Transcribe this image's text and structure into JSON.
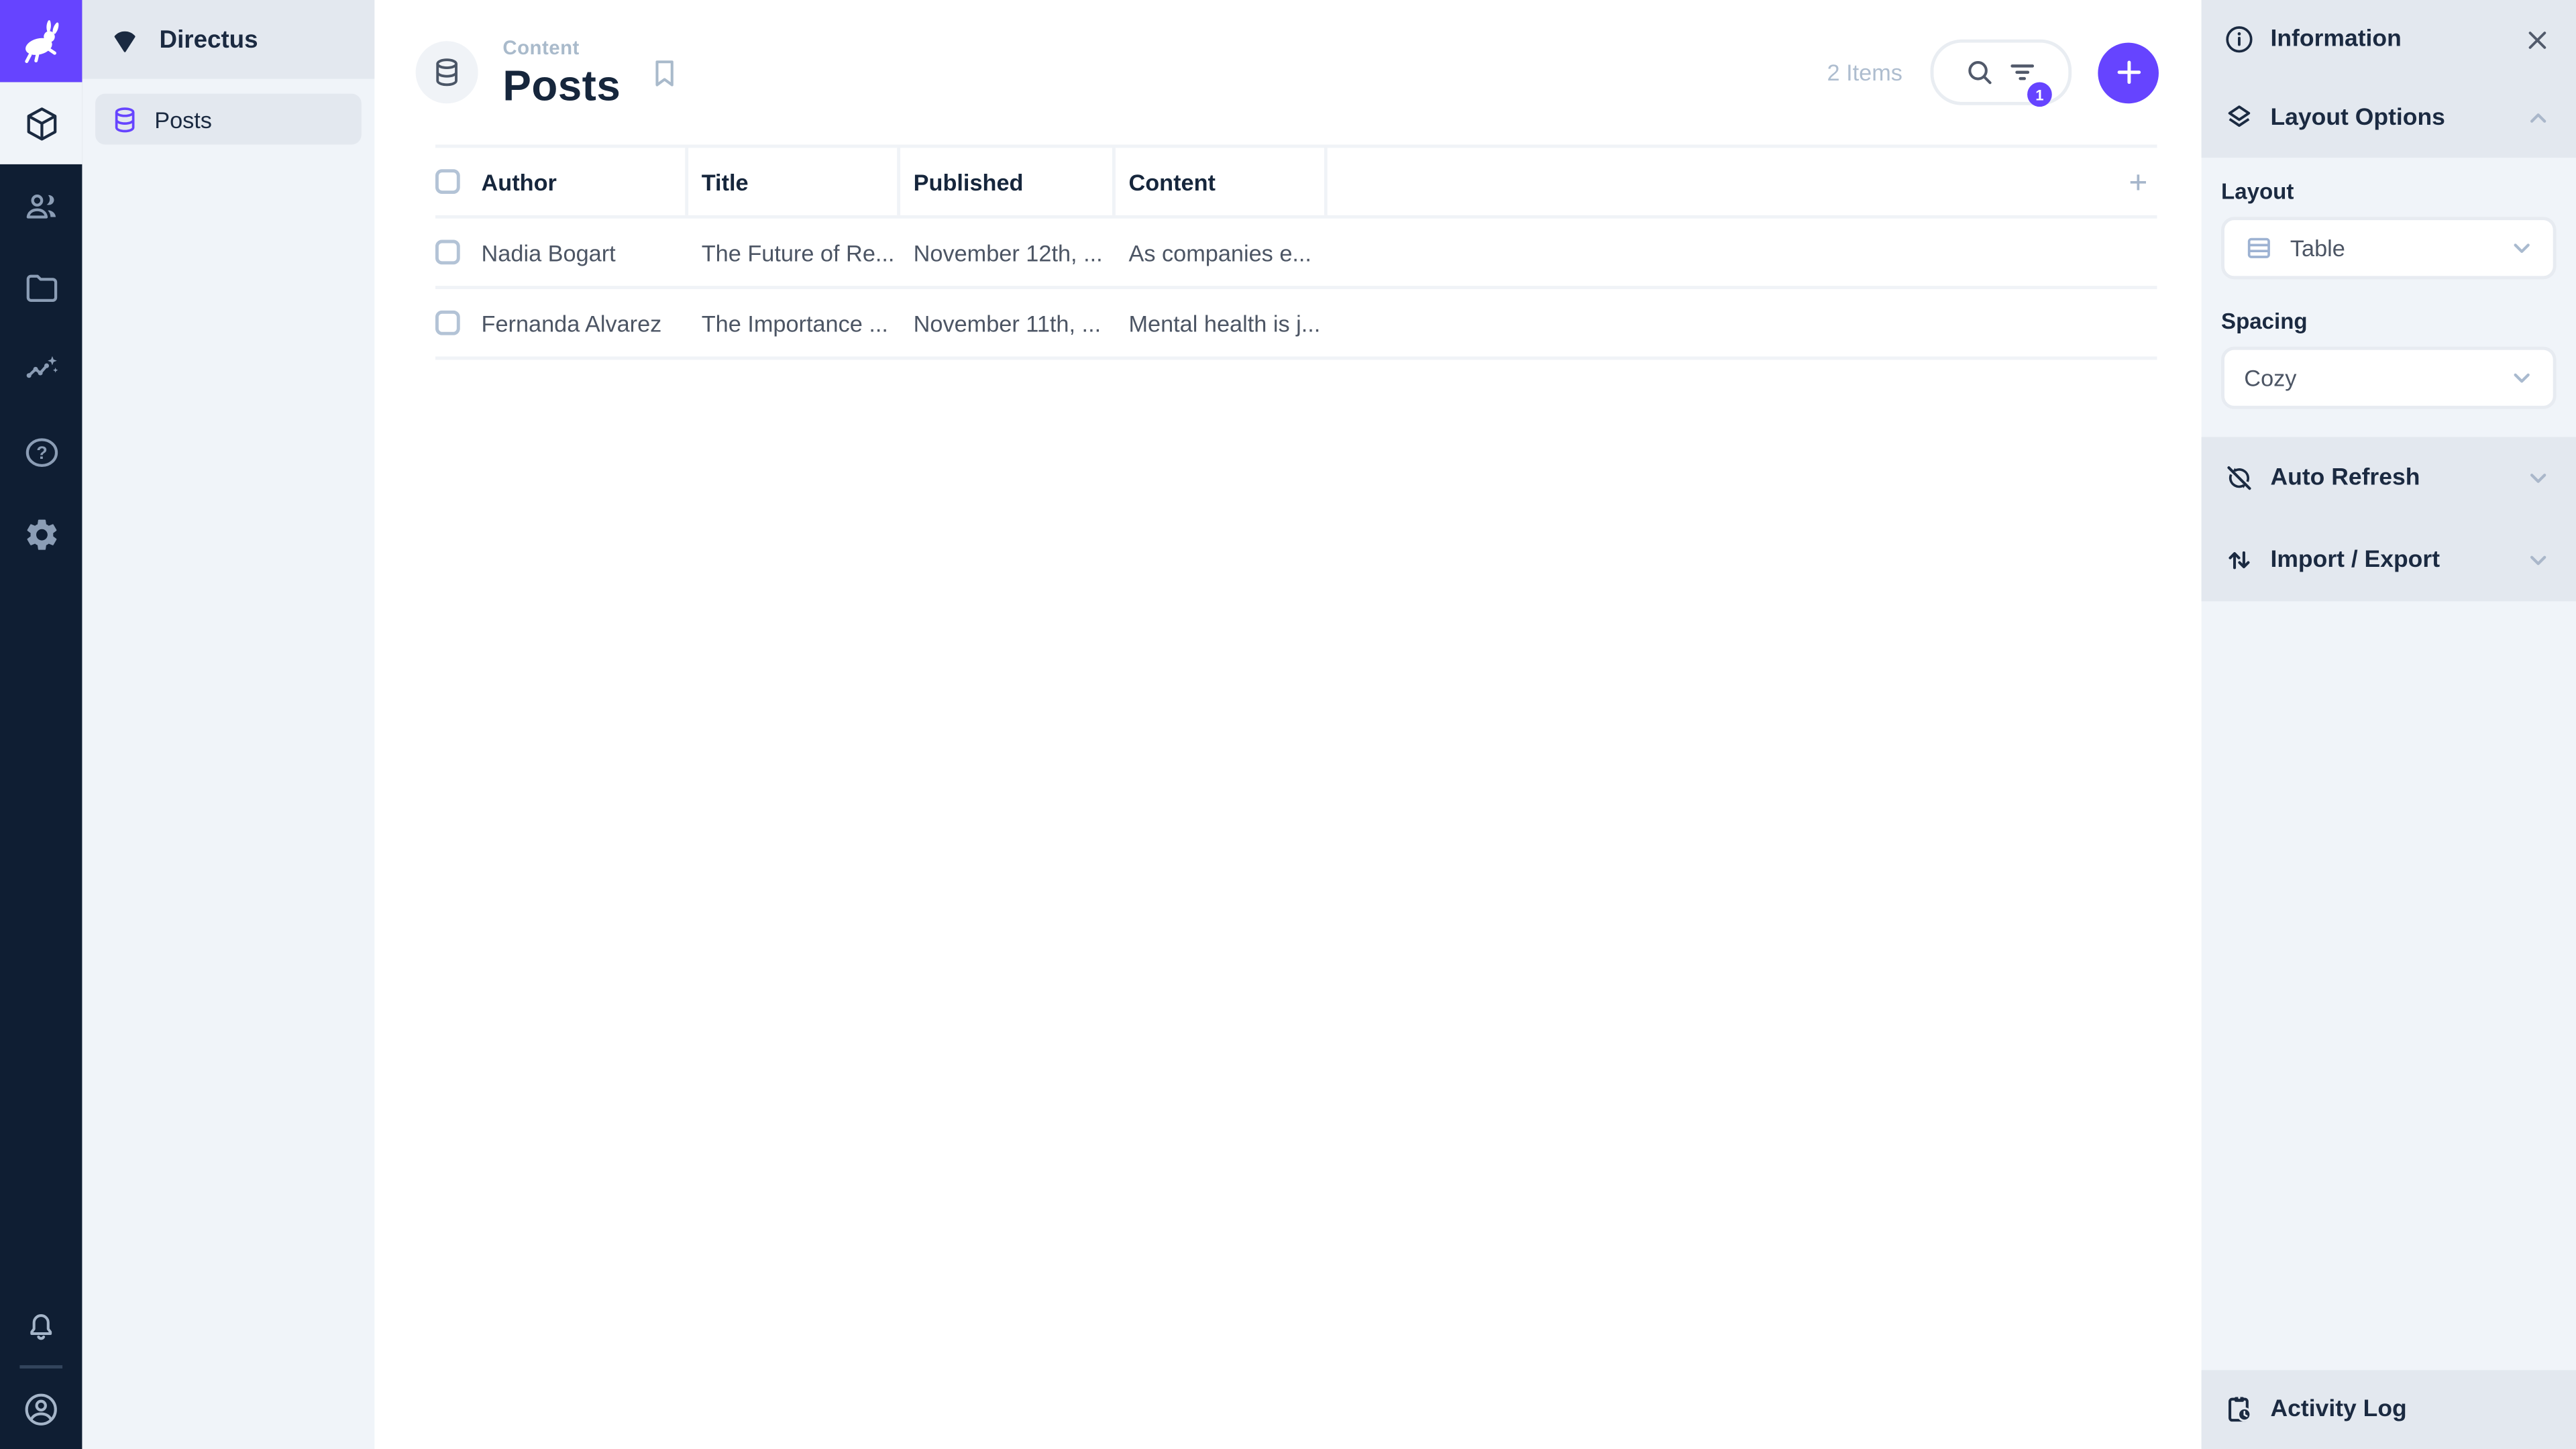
{
  "app": {
    "project_name": "Directus"
  },
  "module_bar": {
    "modules": [
      {
        "name": "content",
        "icon": "box-icon",
        "active": true
      },
      {
        "name": "users",
        "icon": "people-icon",
        "active": false
      },
      {
        "name": "files",
        "icon": "folder-icon",
        "active": false
      },
      {
        "name": "insights",
        "icon": "insights-icon",
        "active": false
      },
      {
        "name": "help",
        "icon": "help-icon",
        "active": false
      },
      {
        "name": "settings",
        "icon": "gear-icon",
        "active": false
      }
    ],
    "notifications_icon": "bell-icon",
    "account_icon": "account-circle-icon",
    "logo_icon": "directus-rabbit-icon"
  },
  "nav": {
    "items": [
      {
        "label": "Posts",
        "icon": "database-icon"
      }
    ]
  },
  "header": {
    "breadcrumb": "Content",
    "title": "Posts",
    "collection_icon": "database-icon",
    "bookmark_icon": "bookmark-icon",
    "item_count": "2 Items",
    "search_icon": "search-icon",
    "filter_icon": "filter-icon",
    "filter_badge": "1",
    "add_icon": "plus-icon"
  },
  "table": {
    "columns": [
      "Author",
      "Title",
      "Published",
      "Content"
    ],
    "add_column_icon": "plus-icon",
    "rows": [
      {
        "author": "Nadia Bogart",
        "title": "The Future of Re...",
        "published": "November 12th, ...",
        "content": "As companies e..."
      },
      {
        "author": "Fernanda Alvarez",
        "title": "The Importance ...",
        "published": "November 11th, ...",
        "content": "Mental health is j..."
      }
    ]
  },
  "sidebar": {
    "information": {
      "label": "Information",
      "icon": "info-icon",
      "close_icon": "close-icon"
    },
    "layout_options": {
      "label": "Layout Options",
      "icon": "layers-icon",
      "chevron": "chevron-up-icon",
      "layout_field": {
        "label": "Layout",
        "value": "Table",
        "icon": "table-icon",
        "chevron": "chevron-down-icon"
      },
      "spacing_field": {
        "label": "Spacing",
        "value": "Cozy",
        "chevron": "chevron-down-icon"
      }
    },
    "auto_refresh": {
      "label": "Auto Refresh",
      "icon": "sync-disabled-icon",
      "chevron": "chevron-down-icon"
    },
    "import_export": {
      "label": "Import / Export",
      "icon": "import-export-icon",
      "chevron": "chevron-down-icon"
    },
    "activity_log": {
      "label": "Activity Log",
      "icon": "clipboard-clock-icon"
    }
  },
  "colors": {
    "accent": "#6644ff",
    "module_bar_bg": "#0f1e33",
    "band_bg": "#e3e8ef",
    "surface_light": "#f0f4f9",
    "text_dark": "#172940",
    "text_body": "#4c5564",
    "text_muted": "#a9bacb"
  }
}
